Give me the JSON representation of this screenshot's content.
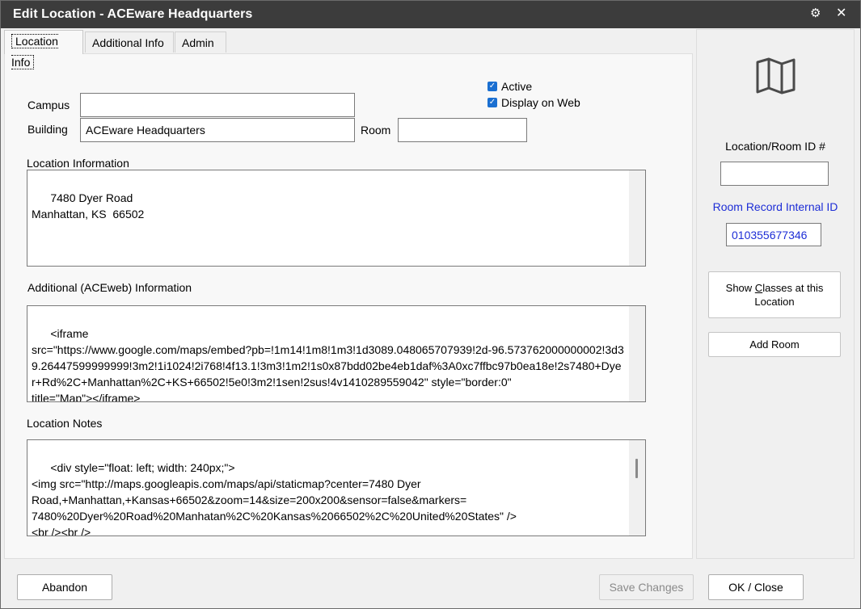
{
  "window": {
    "title": "Edit Location - ACEware Headquarters"
  },
  "tabs": [
    {
      "label": "Location Info",
      "active": true
    },
    {
      "label": "Additional Info",
      "active": false
    },
    {
      "label": "Admin",
      "active": false
    }
  ],
  "form": {
    "campus_label": "Campus",
    "campus_value": "",
    "building_label": "Building",
    "building_value": "ACEware Headquarters",
    "room_label": "Room",
    "room_value": "",
    "active_label": "Active",
    "active_checked": true,
    "web_label": "Display on Web",
    "web_checked": true,
    "location_info_label": "Location Information",
    "location_info_value": "7480 Dyer Road\nManhattan, KS  66502",
    "additional_label": "Additional (ACEweb) Information",
    "additional_value": "<iframe\nsrc=\"https://www.google.com/maps/embed?pb=!1m14!1m8!1m3!1d3089.048065707939!2d-96.573762000000002!3d39.26447599999999!3m2!1i1024!2i768!4f13.1!3m3!1m2!1s0x87bdd02be4eb1daf%3A0xc7ffbc97b0ea18e!2s7480+Dyer+Rd%2C+Manhattan%2C+KS+66502!5e0!3m2!1sen!2sus!4v1410289559042\" style=\"border:0\"\ntitle=\"Map\"></iframe>",
    "notes_label": "Location Notes",
    "notes_value": "<div style=\"float: left; width: 240px;\">\n<img src=\"http://maps.googleapis.com/maps/api/staticmap?center=7480 Dyer\nRoad,+Manhattan,+Kansas+66502&zoom=14&size=200x200&sensor=false&markers=\n7480%20Dyer%20Road%20Manhatan%2C%20Kansas%2066502%2C%20United%20States\" />\n<br /><br />\n<p class=\"awGDirections\">Get Directions</p>"
  },
  "side": {
    "map_icon": "map-icon",
    "room_id_label": "Location/Room ID #",
    "room_id_value": "",
    "internal_id_label": "Room Record Internal ID",
    "internal_id_value": "010355677346",
    "show_classes_prefix": "Show ",
    "show_classes_underline": "C",
    "show_classes_rest": "lasses at this",
    "show_classes_line2": "Location",
    "add_room_label": "Add Room"
  },
  "footer": {
    "abandon_label": "Abandon",
    "save_label": "Save Changes",
    "ok_label": "OK / Close"
  },
  "colors": {
    "titlebar": "#3c3c3c",
    "link_blue": "#1d2dd6",
    "checkbox": "#1a6fd1",
    "disabled_text": "#8a8a8a"
  }
}
